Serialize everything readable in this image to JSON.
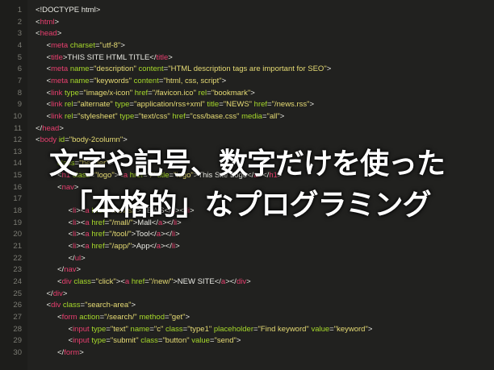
{
  "editor": {
    "lines": [
      {
        "n": "1",
        "indent": 0,
        "parts": [
          [
            "p",
            "<!DOCTYPE html>"
          ]
        ]
      },
      {
        "n": "2",
        "indent": 0,
        "parts": [
          [
            "p",
            "<"
          ],
          [
            "t",
            "html"
          ],
          [
            "p",
            ">"
          ]
        ]
      },
      {
        "n": "3",
        "indent": 0,
        "parts": [
          [
            "p",
            "<"
          ],
          [
            "t",
            "head"
          ],
          [
            "p",
            ">"
          ]
        ]
      },
      {
        "n": "4",
        "indent": 1,
        "parts": [
          [
            "p",
            "<"
          ],
          [
            "t",
            "meta"
          ],
          [
            "p",
            " "
          ],
          [
            "a",
            "charset"
          ],
          [
            "p",
            "="
          ],
          [
            "s",
            "\"utf-8\""
          ],
          [
            "p",
            ">"
          ]
        ]
      },
      {
        "n": "5",
        "indent": 1,
        "parts": [
          [
            "p",
            "<"
          ],
          [
            "t",
            "title"
          ],
          [
            "p",
            ">THIS SITE HTML TITLE</"
          ],
          [
            "t",
            "title"
          ],
          [
            "p",
            ">"
          ]
        ]
      },
      {
        "n": "6",
        "indent": 1,
        "parts": [
          [
            "p",
            "<"
          ],
          [
            "t",
            "meta"
          ],
          [
            "p",
            " "
          ],
          [
            "a",
            "name"
          ],
          [
            "p",
            "="
          ],
          [
            "s",
            "\"description\""
          ],
          [
            "p",
            " "
          ],
          [
            "a",
            "content"
          ],
          [
            "p",
            "="
          ],
          [
            "s",
            "\"HTML description tags are important for SEO\""
          ],
          [
            "p",
            ">"
          ]
        ]
      },
      {
        "n": "7",
        "indent": 1,
        "parts": [
          [
            "p",
            "<"
          ],
          [
            "t",
            "meta"
          ],
          [
            "p",
            " "
          ],
          [
            "a",
            "name"
          ],
          [
            "p",
            "="
          ],
          [
            "s",
            "\"keywords\""
          ],
          [
            "p",
            " "
          ],
          [
            "a",
            "content"
          ],
          [
            "p",
            "="
          ],
          [
            "s",
            "\"html, css, script\""
          ],
          [
            "p",
            ">"
          ]
        ]
      },
      {
        "n": "8",
        "indent": 1,
        "parts": [
          [
            "p",
            "<"
          ],
          [
            "t",
            "link"
          ],
          [
            "p",
            " "
          ],
          [
            "a",
            "type"
          ],
          [
            "p",
            "="
          ],
          [
            "s",
            "\"image/x-icon\""
          ],
          [
            "p",
            " "
          ],
          [
            "a",
            "href"
          ],
          [
            "p",
            "="
          ],
          [
            "s",
            "\"/favicon.ico\""
          ],
          [
            "p",
            " "
          ],
          [
            "a",
            "rel"
          ],
          [
            "p",
            "="
          ],
          [
            "s",
            "\"bookmark\""
          ],
          [
            "p",
            ">"
          ]
        ]
      },
      {
        "n": "9",
        "indent": 1,
        "parts": [
          [
            "p",
            "<"
          ],
          [
            "t",
            "link"
          ],
          [
            "p",
            " "
          ],
          [
            "a",
            "rel"
          ],
          [
            "p",
            "="
          ],
          [
            "s",
            "\"alternate\""
          ],
          [
            "p",
            " "
          ],
          [
            "a",
            "type"
          ],
          [
            "p",
            "="
          ],
          [
            "s",
            "\"application/rss+xml\""
          ],
          [
            "p",
            " "
          ],
          [
            "a",
            "title"
          ],
          [
            "p",
            "="
          ],
          [
            "s",
            "\"NEWS\""
          ],
          [
            "p",
            " "
          ],
          [
            "a",
            "href"
          ],
          [
            "p",
            "="
          ],
          [
            "s",
            "\"/news.rss\""
          ],
          [
            "p",
            ">"
          ]
        ]
      },
      {
        "n": "10",
        "indent": 1,
        "parts": [
          [
            "p",
            "<"
          ],
          [
            "t",
            "link"
          ],
          [
            "p",
            " "
          ],
          [
            "a",
            "rel"
          ],
          [
            "p",
            "="
          ],
          [
            "s",
            "\"stylesheet\""
          ],
          [
            "p",
            " "
          ],
          [
            "a",
            "type"
          ],
          [
            "p",
            "="
          ],
          [
            "s",
            "\"text/css\""
          ],
          [
            "p",
            " "
          ],
          [
            "a",
            "href"
          ],
          [
            "p",
            "="
          ],
          [
            "s",
            "\"css/base.css\""
          ],
          [
            "p",
            " "
          ],
          [
            "a",
            "media"
          ],
          [
            "p",
            "="
          ],
          [
            "s",
            "\"all\""
          ],
          [
            "p",
            ">"
          ]
        ]
      },
      {
        "n": "11",
        "indent": 0,
        "parts": [
          [
            "p",
            "</"
          ],
          [
            "t",
            "head"
          ],
          [
            "p",
            ">"
          ]
        ]
      },
      {
        "n": "12",
        "indent": 0,
        "parts": [
          [
            "p",
            "<"
          ],
          [
            "t",
            "body"
          ],
          [
            "p",
            " "
          ],
          [
            "a",
            "id"
          ],
          [
            "p",
            "="
          ],
          [
            "s",
            "\"body-2column\""
          ],
          [
            "p",
            ">"
          ]
        ]
      },
      {
        "n": "13",
        "indent": 1,
        "parts": []
      },
      {
        "n": "14",
        "indent": 2,
        "parts": [
          [
            "a",
            "class"
          ],
          [
            "p",
            "="
          ],
          [
            "s",
            "\"header\""
          ],
          [
            "p",
            ">"
          ]
        ]
      },
      {
        "n": "15",
        "indent": 2,
        "parts": [
          [
            "p",
            "<"
          ],
          [
            "t",
            "h1"
          ],
          [
            "p",
            " "
          ],
          [
            "a",
            "class"
          ],
          [
            "p",
            "="
          ],
          [
            "s",
            "\"logo\""
          ],
          [
            "p",
            "><"
          ],
          [
            "t",
            "a"
          ],
          [
            "p",
            " "
          ],
          [
            "a",
            "href"
          ],
          [
            "p",
            "="
          ],
          [
            "s",
            "\"/\""
          ],
          [
            "p",
            " "
          ],
          [
            "a",
            "title"
          ],
          [
            "p",
            "="
          ],
          [
            "s",
            "\"logo\""
          ],
          [
            "p",
            ">This Site Logo</"
          ],
          [
            "t",
            "a"
          ],
          [
            "p",
            "></"
          ],
          [
            "t",
            "h1"
          ],
          [
            "p",
            ">"
          ]
        ]
      },
      {
        "n": "16",
        "indent": 2,
        "parts": [
          [
            "p",
            "<"
          ],
          [
            "t",
            "nav"
          ],
          [
            "p",
            ">"
          ]
        ]
      },
      {
        "n": "17",
        "indent": 2,
        "parts": []
      },
      {
        "n": "18",
        "indent": 3,
        "parts": [
          [
            "p",
            "<"
          ],
          [
            "t",
            "li"
          ],
          [
            "p",
            "><"
          ],
          [
            "t",
            "a"
          ],
          [
            "p",
            " "
          ],
          [
            "a",
            "href"
          ],
          [
            "p",
            "="
          ],
          [
            "s",
            "\"/news/\""
          ],
          [
            "p",
            ">NEWS</"
          ],
          [
            "t",
            "a"
          ],
          [
            "p",
            "></"
          ],
          [
            "t",
            "li"
          ],
          [
            "p",
            ">"
          ]
        ]
      },
      {
        "n": "19",
        "indent": 3,
        "parts": [
          [
            "p",
            "<"
          ],
          [
            "t",
            "li"
          ],
          [
            "p",
            "><"
          ],
          [
            "t",
            "a"
          ],
          [
            "p",
            " "
          ],
          [
            "a",
            "href"
          ],
          [
            "p",
            "="
          ],
          [
            "s",
            "\"/mall/\""
          ],
          [
            "p",
            ">Mall</"
          ],
          [
            "t",
            "a"
          ],
          [
            "p",
            "></"
          ],
          [
            "t",
            "li"
          ],
          [
            "p",
            ">"
          ]
        ]
      },
      {
        "n": "20",
        "indent": 3,
        "parts": [
          [
            "p",
            "<"
          ],
          [
            "t",
            "li"
          ],
          [
            "p",
            "><"
          ],
          [
            "t",
            "a"
          ],
          [
            "p",
            " "
          ],
          [
            "a",
            "href"
          ],
          [
            "p",
            "="
          ],
          [
            "s",
            "\"/tool/\""
          ],
          [
            "p",
            ">Tool</"
          ],
          [
            "t",
            "a"
          ],
          [
            "p",
            "></"
          ],
          [
            "t",
            "li"
          ],
          [
            "p",
            ">"
          ]
        ]
      },
      {
        "n": "21",
        "indent": 3,
        "parts": [
          [
            "p",
            "<"
          ],
          [
            "t",
            "li"
          ],
          [
            "p",
            "><"
          ],
          [
            "t",
            "a"
          ],
          [
            "p",
            " "
          ],
          [
            "a",
            "href"
          ],
          [
            "p",
            "="
          ],
          [
            "s",
            "\"/app/\""
          ],
          [
            "p",
            ">App</"
          ],
          [
            "t",
            "a"
          ],
          [
            "p",
            "></"
          ],
          [
            "t",
            "li"
          ],
          [
            "p",
            ">"
          ]
        ]
      },
      {
        "n": "22",
        "indent": 3,
        "parts": [
          [
            "p",
            "</"
          ],
          [
            "t",
            "ul"
          ],
          [
            "p",
            ">"
          ]
        ]
      },
      {
        "n": "23",
        "indent": 2,
        "parts": [
          [
            "p",
            "</"
          ],
          [
            "t",
            "nav"
          ],
          [
            "p",
            ">"
          ]
        ]
      },
      {
        "n": "24",
        "indent": 2,
        "parts": [
          [
            "p",
            "<"
          ],
          [
            "t",
            "div"
          ],
          [
            "p",
            " "
          ],
          [
            "a",
            "class"
          ],
          [
            "p",
            "="
          ],
          [
            "s",
            "\"click\""
          ],
          [
            "p",
            "><"
          ],
          [
            "t",
            "a"
          ],
          [
            "p",
            " "
          ],
          [
            "a",
            "href"
          ],
          [
            "p",
            "="
          ],
          [
            "s",
            "\"/new/\""
          ],
          [
            "p",
            ">NEW SITE</"
          ],
          [
            "t",
            "a"
          ],
          [
            "p",
            "></"
          ],
          [
            "t",
            "div"
          ],
          [
            "p",
            ">"
          ]
        ]
      },
      {
        "n": "25",
        "indent": 1,
        "parts": [
          [
            "p",
            "</"
          ],
          [
            "t",
            "div"
          ],
          [
            "p",
            ">"
          ]
        ]
      },
      {
        "n": "26",
        "indent": 1,
        "parts": [
          [
            "p",
            "<"
          ],
          [
            "t",
            "div"
          ],
          [
            "p",
            " "
          ],
          [
            "a",
            "class"
          ],
          [
            "p",
            "="
          ],
          [
            "s",
            "\"search-area\""
          ],
          [
            "p",
            ">"
          ]
        ]
      },
      {
        "n": "27",
        "indent": 2,
        "parts": [
          [
            "p",
            "<"
          ],
          [
            "t",
            "form"
          ],
          [
            "p",
            " "
          ],
          [
            "a",
            "action"
          ],
          [
            "p",
            "="
          ],
          [
            "s",
            "\"/search/\""
          ],
          [
            "p",
            " "
          ],
          [
            "a",
            "method"
          ],
          [
            "p",
            "="
          ],
          [
            "s",
            "\"get\""
          ],
          [
            "p",
            ">"
          ]
        ]
      },
      {
        "n": "28",
        "indent": 3,
        "parts": [
          [
            "p",
            "<"
          ],
          [
            "t",
            "input"
          ],
          [
            "p",
            " "
          ],
          [
            "a",
            "type"
          ],
          [
            "p",
            "="
          ],
          [
            "s",
            "\"text\""
          ],
          [
            "p",
            " "
          ],
          [
            "a",
            "name"
          ],
          [
            "p",
            "="
          ],
          [
            "s",
            "\"c\""
          ],
          [
            "p",
            " "
          ],
          [
            "a",
            "class"
          ],
          [
            "p",
            "="
          ],
          [
            "s",
            "\"type1\""
          ],
          [
            "p",
            " "
          ],
          [
            "a",
            "placeholder"
          ],
          [
            "p",
            "="
          ],
          [
            "s",
            "\"Find keyword\""
          ],
          [
            "p",
            " "
          ],
          [
            "a",
            "value"
          ],
          [
            "p",
            "="
          ],
          [
            "s",
            "\"keyword\""
          ],
          [
            "p",
            ">"
          ]
        ]
      },
      {
        "n": "29",
        "indent": 3,
        "parts": [
          [
            "p",
            "<"
          ],
          [
            "t",
            "input"
          ],
          [
            "p",
            " "
          ],
          [
            "a",
            "type"
          ],
          [
            "p",
            "="
          ],
          [
            "s",
            "\"submit\""
          ],
          [
            "p",
            " "
          ],
          [
            "a",
            "class"
          ],
          [
            "p",
            "="
          ],
          [
            "s",
            "\"button\""
          ],
          [
            "p",
            " "
          ],
          [
            "a",
            "value"
          ],
          [
            "p",
            "="
          ],
          [
            "s",
            "\"send\""
          ],
          [
            "p",
            ">"
          ]
        ]
      },
      {
        "n": "30",
        "indent": 2,
        "parts": [
          [
            "p",
            "</"
          ],
          [
            "t",
            "form"
          ],
          [
            "p",
            ">"
          ]
        ]
      }
    ]
  },
  "overlay": {
    "line1": "文字や記号、数字だけを使った",
    "line2": "「本格的」なプログラミング"
  },
  "colors": {
    "background": "#21211f",
    "gutter": "#1d1d1b",
    "line_number": "#7c7c74",
    "tag": "#e83f6f",
    "attribute": "#a6d82b",
    "string": "#e6db74",
    "plain": "#e8e8e2",
    "overlay_text": "#ffffff"
  }
}
